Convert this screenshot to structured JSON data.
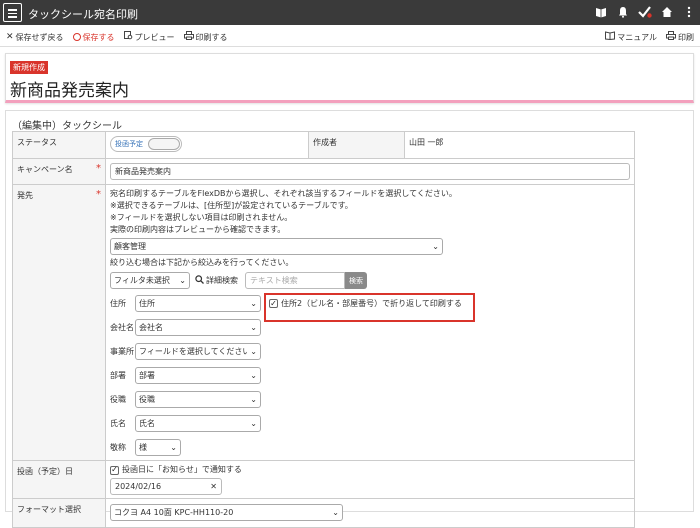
{
  "header": {
    "title": "タックシール宛名印刷"
  },
  "toolbar": {
    "left": [
      "保存せず戻る",
      "保存する",
      "プレビュー",
      "印刷する"
    ],
    "right": [
      "マニュアル",
      "印刷"
    ]
  },
  "title_area": {
    "badge": "新規作成",
    "title": "新商品発売案内"
  },
  "section_title": "（編集中）タックシール",
  "rows": {
    "status": {
      "label": "ステータス",
      "toggle": "投函予定",
      "author_label": "作成者",
      "author": "山田 一郎"
    },
    "campaign": {
      "label": "キャンペーン名",
      "value": "新商品発売案内"
    },
    "destination": {
      "label": "発先",
      "notes": [
        "宛名印刷するテーブルをFlexDBから選択し、それぞれ該当するフィールドを選択してください。",
        "※選択できるテーブルは、[住所型]が設定されているテーブルです。",
        "※フィールドを選択しない項目は印刷されません。",
        "実際の印刷内容はプレビューから確認できます。"
      ],
      "table_select": "顧客管理",
      "filter_note": "絞り込む場合は下記から絞込みを行ってください。",
      "filter_select": "フィルタ未選択",
      "detail_search": "詳細検索",
      "search_placeholder": "テキスト検索",
      "search_button": "検索",
      "fields": [
        {
          "label": "住所",
          "value": "住所"
        },
        {
          "label": "会社名",
          "value": "会社名"
        },
        {
          "label": "事業所",
          "value": "フィールドを選択してください"
        },
        {
          "label": "部署",
          "value": "部署"
        },
        {
          "label": "役職",
          "value": "役職"
        },
        {
          "label": "氏名",
          "value": "氏名"
        },
        {
          "label": "敬称",
          "value": "様"
        }
      ],
      "wrap_option": "住所2（ビル名・部屋番号）で折り返して印刷する"
    },
    "post_date": {
      "label": "投函（予定）日",
      "notify": "投函日に「お知らせ」で通知する",
      "date": "2024/02/16"
    },
    "format": {
      "label": "フォーマット選択",
      "value": "コクヨ A4 10面 KPC-HH110-20"
    }
  },
  "colors": {
    "header_bg": "#3a3a3a",
    "accent_red": "#d9342b",
    "pink_underline": "#f3a0bd"
  }
}
